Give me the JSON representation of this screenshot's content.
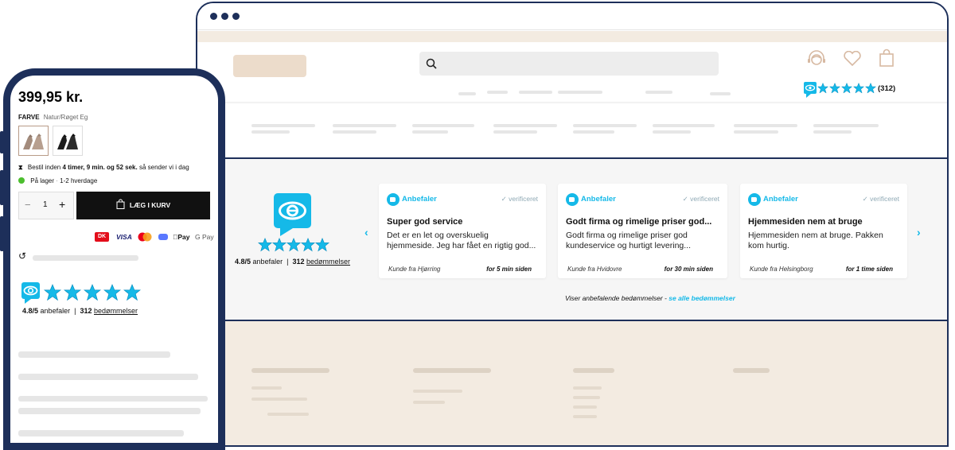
{
  "desktop": {
    "header": {
      "rating_count": "(312)"
    },
    "reviews": {
      "widget_score": "4.8/5",
      "widget_anbefaler": "anbefaler",
      "widget_sep": "|",
      "widget_count": "312",
      "widget_count_label": "bedømmelser",
      "cards": [
        {
          "recommend": "Anbefaler",
          "verified": "verificeret",
          "title": "Super god service",
          "body": "Det er en let og overskuelig hjemmeside. Jeg har fået en rigtig god...",
          "from": "Kunde fra Hjørring",
          "when": "for 5 min siden"
        },
        {
          "recommend": "Anbefaler",
          "verified": "verificeret",
          "title": "Godt firma og rimelige priser god...",
          "body": "Godt firma og rimelige priser god kundeservice og hurtigt levering...",
          "from": "Kunde fra Hvidovre",
          "when": "for 30 min siden"
        },
        {
          "recommend": "Anbefaler",
          "verified": "verificeret",
          "title": "Hjemmesiden nem at bruge",
          "body": "Hjemmesiden nem at bruge. Pakken kom hurtig.",
          "from": "Kunde fra Helsingborg",
          "when": "for 1 time siden"
        }
      ],
      "footer_text": "Viser anbefalende bedømmelser -",
      "footer_link": "se alle bedømmelser"
    }
  },
  "phone": {
    "price": "399,95 kr.",
    "color_label": "FARVE",
    "color_value": "Natur/Røget Eg",
    "delivery_prefix": "Bestil inden",
    "delivery_time": "4 timer, 9 min. og 52 sek.",
    "delivery_suffix": "så sender vi i dag",
    "stock_label": "På lager",
    "stock_sep": "·",
    "stock_days": "1-2 hverdage",
    "quantity": "1",
    "qty_minus": "−",
    "qty_plus": "+",
    "add_to_cart": "LÆG I KURV",
    "payments": {
      "dk": "DK",
      "visa": "VISA",
      "applepay": "Pay",
      "gpay": "G Pay"
    },
    "rating_score": "4.8/5",
    "rating_anbefaler": "anbefaler",
    "rating_sep": "|",
    "rating_count": "312",
    "rating_count_label": "bedømmelser"
  },
  "colors": {
    "navy": "#1d2f5a",
    "accent": "#15b9e8",
    "beige": "#f3ebe1",
    "icon_tan": "#d7b9a2"
  }
}
